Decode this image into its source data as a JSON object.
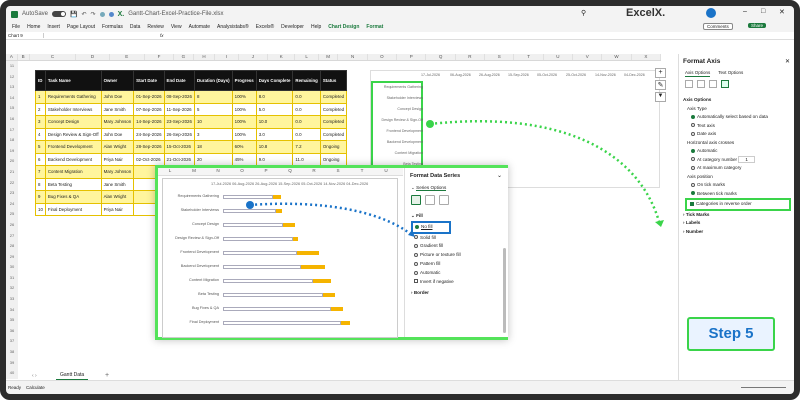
{
  "title_bar": {
    "autosave": "AutoSave",
    "toggle": "Off",
    "filename": "Gantt-Chart-Excel-Practice-File.xlsx",
    "logo": "ExcelX."
  },
  "menu": [
    "File",
    "Home",
    "Insert",
    "Page Layout",
    "Formulas",
    "Data",
    "Review",
    "View",
    "Automate",
    "Analysistabs®",
    "Excels®",
    "Developer",
    "Help",
    "Chart Design",
    "Format"
  ],
  "ribbon_right": {
    "comments": "Comments",
    "share": "Share"
  },
  "formula_bar": {
    "name_box": "Chart 9",
    "fx": "fx"
  },
  "columns": [
    "A",
    "B",
    "C",
    "D",
    "E",
    "F",
    "G",
    "H",
    "I",
    "J",
    "K",
    "L",
    "M",
    "N",
    "O",
    "P",
    "Q",
    "R",
    "S",
    "T",
    "U",
    "V",
    "W",
    "X"
  ],
  "rows": [
    "11",
    "12",
    "13",
    "14",
    "15",
    "16",
    "17",
    "18",
    "19",
    "20",
    "21",
    "22",
    "23",
    "24",
    "25",
    "26",
    "27",
    "28",
    "29",
    "30",
    "31",
    "32",
    "33",
    "34",
    "35",
    "36",
    "37",
    "38",
    "39",
    "40"
  ],
  "table": {
    "headers": [
      "ID",
      "Task Name",
      "Owner",
      "Start Date",
      "End Date",
      "Duration (Days)",
      "Progress",
      "Days Complete",
      "Remaining",
      "Status"
    ],
    "rows": [
      [
        "1",
        "Requirements Gathering",
        "John Doe",
        "01-Sep-2026",
        "08-Sep-2026",
        "8",
        "100%",
        "8.0",
        "0.0",
        "Completed"
      ],
      [
        "2",
        "Stakeholder Interviews",
        "Jane Smith",
        "07-Sep-2026",
        "11-Sep-2026",
        "5",
        "100%",
        "5.0",
        "0.0",
        "Completed"
      ],
      [
        "3",
        "Concept Design",
        "Mary Johnson",
        "14-Sep-2026",
        "23-Sep-2026",
        "10",
        "100%",
        "10.0",
        "0.0",
        "Completed"
      ],
      [
        "4",
        "Design Review & Sign-Off",
        "John Doe",
        "24-Sep-2026",
        "26-Sep-2026",
        "3",
        "100%",
        "3.0",
        "0.0",
        "Completed"
      ],
      [
        "5",
        "Frontend Development",
        "Alan Wright",
        "28-Sep-2026",
        "15-Oct-2026",
        "18",
        "60%",
        "10.8",
        "7.2",
        "Ongoing"
      ],
      [
        "6",
        "Backend Development",
        "Priya Nair",
        "02-Oct-2026",
        "21-Oct-2026",
        "20",
        "45%",
        "9.0",
        "11.0",
        "Ongoing"
      ],
      [
        "7",
        "Content Migration",
        "Mary Johnson",
        "",
        "",
        "",
        "",
        "",
        "",
        ""
      ],
      [
        "8",
        "Beta Testing",
        "Jane Smith",
        "",
        "",
        "",
        "",
        "",
        "",
        ""
      ],
      [
        "9",
        "Bug Fixes & QA",
        "Alan Wright",
        "",
        "",
        "",
        "",
        "",
        "",
        ""
      ],
      [
        "10",
        "Final Deployment",
        "Priya Nair",
        "",
        "",
        "",
        "",
        "",
        "",
        ""
      ]
    ]
  },
  "chart": {
    "dates": [
      "17-Jul-2026",
      "06-Aug-2026",
      "26-Aug-2026",
      "15-Sep-2026",
      "05-Oct-2026",
      "25-Oct-2026",
      "14-Nov-2026",
      "04-Dec-2026"
    ],
    "tasks": [
      "Requirements Gathering",
      "Stakeholder Interviews",
      "Concept Design",
      "Design Review & Sign-Off",
      "Frontend Development",
      "Backend Development",
      "Content Migration",
      "Beta Testing",
      "Bug Fixes & QA",
      "Final Deployment"
    ]
  },
  "format_axis": {
    "title": "Format Axis",
    "tabs": [
      "Axis Options",
      "Text Options"
    ],
    "section": "Axis Options",
    "axis_type_label": "Axis Type",
    "axis_type_options": [
      "Automatically select based on data",
      "Text axis",
      "Date axis"
    ],
    "crosses_label": "Horizontal axis crosses",
    "crosses_options": [
      "Automatic",
      "At category number",
      "At maximum category"
    ],
    "category_number": "1",
    "position_label": "Axis position",
    "position_options": [
      "On tick marks",
      "Between tick marks"
    ],
    "reverse_label": "Categories in reverse order",
    "collapsed": [
      "Tick Marks",
      "Labels",
      "Number"
    ]
  },
  "format_series": {
    "title": "Format Data Series",
    "tab": "Series Options",
    "section": "Fill",
    "options": [
      "No fill",
      "Solid fill",
      "Gradient fill",
      "Picture or texture fill",
      "Pattern fill",
      "Automatic"
    ],
    "invert": "Invert if negative",
    "border": "Border"
  },
  "zoom_chart": {
    "cols": [
      "L",
      "M",
      "N",
      "O",
      "P",
      "Q",
      "R",
      "S",
      "T",
      "U"
    ],
    "dates": "17-Jul-2026 06-Aug-2026 26-Aug-2026 15-Sep-2026 05-Oct-2026 14-Nov-2026 04-Dec-2026"
  },
  "step": "Step 5",
  "sheet_tab": "Gantt Data",
  "status": {
    "ready": "Ready",
    "calc": "Calculate"
  },
  "colors": {
    "accent": "#1b7a3d",
    "bar": "#f5b400",
    "highlight": "#3ad44a",
    "step_text": "#1a73c8"
  }
}
